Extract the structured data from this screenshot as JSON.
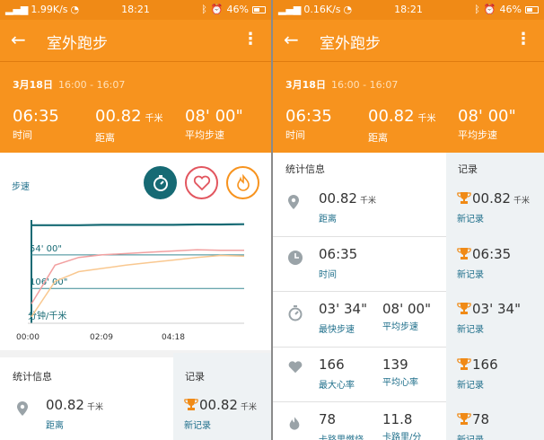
{
  "left": {
    "status": {
      "speed": "1.99K/s",
      "time": "18:21",
      "battery": "46%"
    },
    "app": {
      "title": "室外跑步"
    },
    "header": {
      "date": "3月18日",
      "range": "16:00 - 16:07"
    },
    "summary": [
      {
        "value": "06:35",
        "unit": "",
        "label": "时间"
      },
      {
        "value": "00.82",
        "unit": "千米",
        "label": "距离"
      },
      {
        "value": "08' 00\"",
        "unit": "",
        "label": "平均步速"
      }
    ],
    "chart_data": {
      "type": "line",
      "title": "步速",
      "ylabel": "分钟/千米",
      "y_ticks": [
        "54' 00\"",
        "106' 00\""
      ],
      "x": [
        "00:00",
        "02:09",
        "04:18"
      ],
      "y_ticks_values_minutes": [
        54,
        106
      ],
      "ylim_minutes": [
        0,
        160
      ],
      "grid": true,
      "legend": "none",
      "series": [
        {
          "values_minutes": [
            8,
            8,
            8,
            7.5,
            7.5,
            7.5,
            7.5,
            7,
            7,
            6.5
          ]
        },
        {
          "values_minutes": [
            130,
            70,
            58,
            54,
            52,
            50,
            48,
            46,
            47,
            47
          ]
        },
        {
          "values_minutes": [
            150,
            95,
            80,
            75,
            70,
            66,
            62,
            58,
            55,
            56
          ]
        }
      ],
      "colors": {
        "pace": "#166a74",
        "heart": "#f2a0a0",
        "calorie": "#f9c890"
      }
    },
    "stats": {
      "head": "统计信息",
      "record_head": "记录",
      "rows": [
        {
          "value": "00.82",
          "unit": "千米",
          "label": "距离",
          "record": "00.82",
          "record_unit": "千米",
          "record_label": "新记录"
        }
      ]
    }
  },
  "right": {
    "status": {
      "speed": "0.16K/s",
      "time": "18:21",
      "battery": "46%"
    },
    "app": {
      "title": "室外跑步"
    },
    "header": {
      "date": "3月18日",
      "range": "16:00 - 16:07"
    },
    "summary": [
      {
        "value": "06:35",
        "unit": "",
        "label": "时间"
      },
      {
        "value": "00.82",
        "unit": "千米",
        "label": "距离"
      },
      {
        "value": "08' 00\"",
        "unit": "",
        "label": "平均步速"
      }
    ],
    "stats": {
      "head": "统计信息",
      "record_head": "记录",
      "rows": [
        {
          "icon": "location-icon",
          "a_value": "00.82",
          "a_unit": "千米",
          "a_label": "距离",
          "b_value": "",
          "b_label": "",
          "record": "00.82",
          "record_unit": "千米",
          "record_label": "新记录"
        },
        {
          "icon": "clock-icon",
          "a_value": "06:35",
          "a_unit": "",
          "a_label": "时间",
          "b_value": "",
          "b_label": "",
          "record": "06:35",
          "record_unit": "",
          "record_label": "新记录"
        },
        {
          "icon": "stopwatch-icon",
          "a_value": "03' 34\"",
          "a_unit": "",
          "a_label": "最快步速",
          "b_value": "08' 00\"",
          "b_label": "平均步速",
          "record": "03' 34\"",
          "record_unit": "",
          "record_label": "新记录"
        },
        {
          "icon": "heart-icon",
          "a_value": "166",
          "a_unit": "",
          "a_label": "最大心率",
          "b_value": "139",
          "b_label": "平均心率",
          "record": "166",
          "record_unit": "",
          "record_label": "新记录"
        },
        {
          "icon": "fire-icon",
          "a_value": "78",
          "a_unit": "",
          "a_label": "卡路里燃烧",
          "b_value": "11.8",
          "b_label": "卡路里/分",
          "record": "78",
          "record_unit": "",
          "record_label": "新记录"
        }
      ]
    }
  },
  "icons": {
    "back": "arrow-left-icon",
    "menu": "more-vertical-icon",
    "trophy": "trophy-icon"
  },
  "colors": {
    "accent": "#f7931e",
    "teal": "#166a74",
    "label": "#1f6f8b"
  }
}
